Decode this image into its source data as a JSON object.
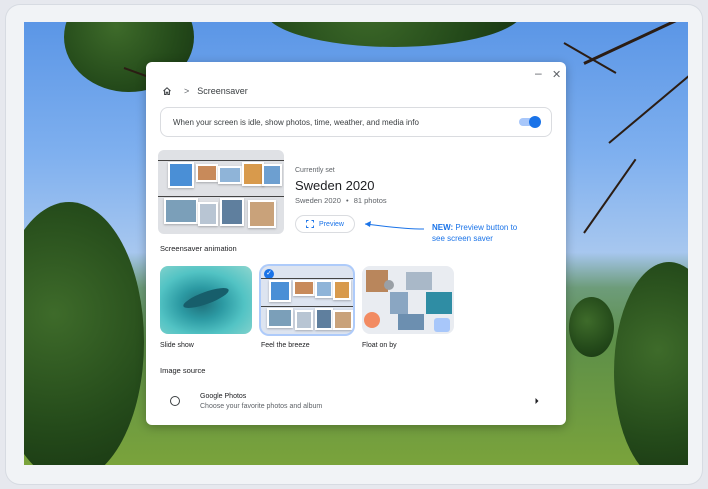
{
  "window": {
    "minimize_icon": "–",
    "close_icon": "✕"
  },
  "breadcrumb": {
    "home_icon": "home",
    "separator": ">",
    "page": "Screensaver"
  },
  "idle_toggle": {
    "label": "When your screen is idle, show photos, time, weather, and media info",
    "state": "on"
  },
  "current": {
    "caption": "Currently set",
    "album_title": "Sweden 2020",
    "album_name": "Sweden 2020",
    "separator": "•",
    "photo_count": "81 photos"
  },
  "preview_button": {
    "label": "Preview"
  },
  "animation_section": {
    "title": "Screensaver animation",
    "options": [
      {
        "label": "Slide show",
        "selected": false
      },
      {
        "label": "Feel the breeze",
        "selected": true
      },
      {
        "label": "Float on by",
        "selected": false
      }
    ]
  },
  "image_source": {
    "title": "Image source",
    "options": [
      {
        "title": "Google Photos",
        "subtitle": "Choose your favorite photos and album"
      }
    ]
  },
  "annotation": {
    "bold": "NEW:",
    "text": "Preview button to",
    "text2": "see screen saver"
  },
  "colors": {
    "accent": "#1a73e8",
    "annotation": "#1a73e8"
  }
}
